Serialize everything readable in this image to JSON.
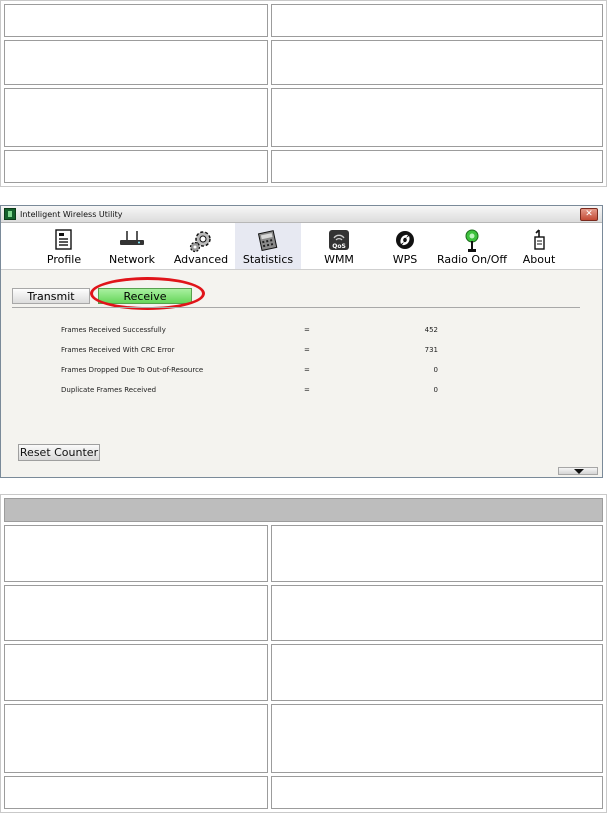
{
  "window": {
    "title": "Intelligent Wireless Utility"
  },
  "toolbar": {
    "items": [
      {
        "label": "Profile",
        "icon": "profile-icon"
      },
      {
        "label": "Network",
        "icon": "network-icon"
      },
      {
        "label": "Advanced",
        "icon": "advanced-icon"
      },
      {
        "label": "Statistics",
        "icon": "statistics-icon",
        "active": true
      },
      {
        "label": "WMM",
        "icon": "wmm-icon"
      },
      {
        "label": "WPS",
        "icon": "wps-icon"
      },
      {
        "label": "Radio On/Off",
        "icon": "radio-icon"
      },
      {
        "label": "About",
        "icon": "about-icon"
      }
    ]
  },
  "tabs": {
    "transmit": "Transmit",
    "receive": "Receive"
  },
  "stats": {
    "rows": [
      {
        "label": "Frames Received Successfully",
        "eq": "=",
        "value": "452"
      },
      {
        "label": "Frames Received With CRC Error",
        "eq": "=",
        "value": "731"
      },
      {
        "label": "Frames Dropped Due To Out-of-Resource",
        "eq": "=",
        "value": "0"
      },
      {
        "label": "Duplicate Frames Received",
        "eq": "=",
        "value": "0"
      }
    ]
  },
  "buttons": {
    "reset_counter": "Reset Counter"
  },
  "colors": {
    "receive_tab": "#67d65b",
    "highlight": "#e0141a",
    "active_tool_bg": "#e7e9f2"
  }
}
